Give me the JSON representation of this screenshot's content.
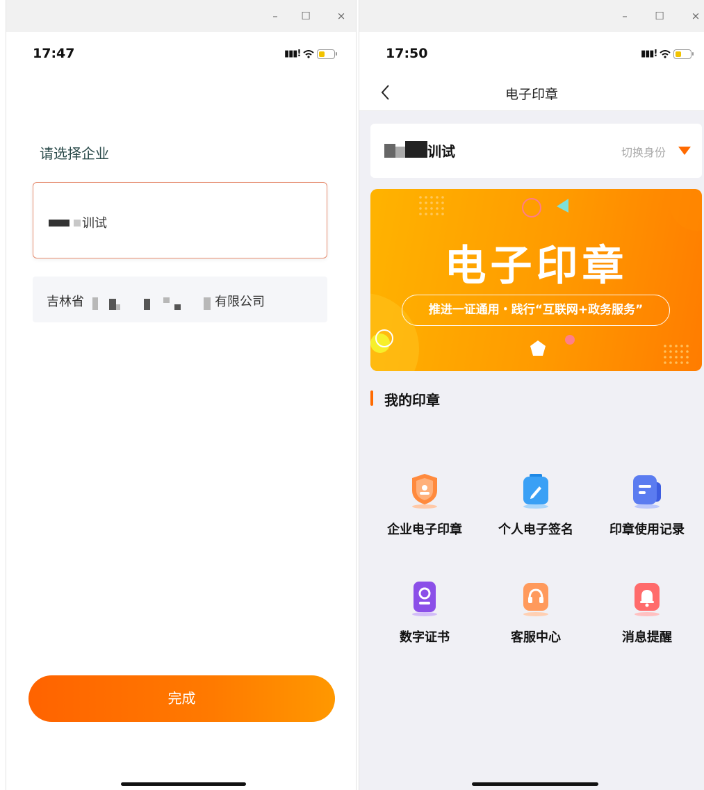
{
  "window_controls": {
    "minimize": "–",
    "maximize": "☐",
    "close": "×"
  },
  "left_screen": {
    "status_time": "17:47",
    "heading": "请选择企业",
    "companies": [
      {
        "name_visible": "训试",
        "selected": true
      },
      {
        "prefix_visible": "吉林省",
        "suffix_visible": "有限公司",
        "selected": false
      }
    ],
    "done_button": "完成"
  },
  "right_screen": {
    "status_time": "17:50",
    "title": "电子印章",
    "identity": {
      "name_visible": "训试",
      "switch_label": "切换身份"
    },
    "banner": {
      "title": "电子印章",
      "slogan": "推进一证通用・践行“互联网+政务服务”"
    },
    "section_title": "我的印章",
    "grid": [
      {
        "label": "企业电子印章",
        "icon": "shield-icon",
        "color": "#ff8a3d"
      },
      {
        "label": "个人电子签名",
        "icon": "pen-clipboard-icon",
        "color": "#3aa0f5"
      },
      {
        "label": "印章使用记录",
        "icon": "record-chat-icon",
        "color": "#5b7cf0"
      },
      {
        "label": "数字证书",
        "icon": "certificate-icon",
        "color": "#8b4fe8"
      },
      {
        "label": "客服中心",
        "icon": "headset-icon",
        "color": "#ff9a5c"
      },
      {
        "label": "消息提醒",
        "icon": "bell-icon",
        "color": "#ff6b6b"
      }
    ]
  }
}
